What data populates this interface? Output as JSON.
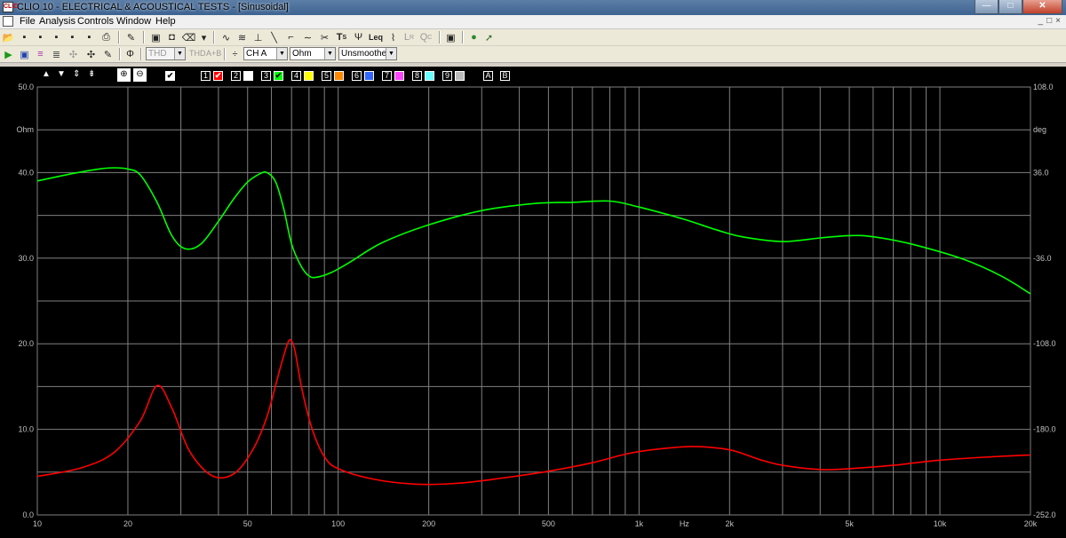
{
  "window": {
    "title": "CLIO 10 - ELECTRICAL & ACOUSTICAL TESTS - [Sinusoidal]",
    "app_icon": "CLIO",
    "min": "—",
    "max": "□",
    "close": "✕"
  },
  "menu": {
    "items": [
      "File",
      "Analysis",
      "Controls",
      "Window",
      "Help"
    ],
    "mdi_buttons": [
      "_",
      "□",
      "×"
    ]
  },
  "toolbar2": {
    "thd_combo": "THD",
    "thd_label": "THD",
    "ab_label": "A+B",
    "channel_combo": "CH A",
    "units_combo": "Ohm",
    "smoothing_combo": "Unsmoothed",
    "ts_label": "T",
    "ts_sub": "S",
    "leq_label": "Leq",
    "lr_label": "L",
    "lr_sub": "R",
    "qc_label": "Q",
    "qc_sub": "C"
  },
  "graph_controls": {
    "overlay_numbers": [
      "1",
      "2",
      "3",
      "4",
      "5",
      "6",
      "7",
      "8",
      "9"
    ],
    "overlay_colors": [
      "#ff0000",
      "#ffffff",
      "#00ff00",
      "#ffff00",
      "#ff8800",
      "#3366ff",
      "#ff44ff",
      "#66ffff",
      "#bbbbbb"
    ],
    "overlay_checked": [
      true,
      false,
      true,
      false,
      false,
      false,
      false,
      false,
      false
    ],
    "ab_letters": [
      "A",
      "B"
    ]
  },
  "chart_data": {
    "type": "line",
    "title": "",
    "xscale": "log",
    "xlim": [
      10,
      20000
    ],
    "x_ticks": [
      {
        "v": 10,
        "label": "10"
      },
      {
        "v": 20,
        "label": "20"
      },
      {
        "v": 50,
        "label": "50"
      },
      {
        "v": 100,
        "label": "100"
      },
      {
        "v": 200,
        "label": "200"
      },
      {
        "v": 500,
        "label": "500"
      },
      {
        "v": 1000,
        "label": "1k"
      },
      {
        "v": 1414,
        "label": "Hz"
      },
      {
        "v": 2000,
        "label": "2k"
      },
      {
        "v": 5000,
        "label": "5k"
      },
      {
        "v": 10000,
        "label": "10k"
      },
      {
        "v": 20000,
        "label": "20k"
      }
    ],
    "xlabel": "Hz",
    "ylabel_left": "Ohm",
    "ylabel_right": "deg",
    "ylim_left": [
      0,
      50
    ],
    "ylim_right": [
      -252,
      108
    ],
    "y_ticks_left": [
      {
        "v": 50,
        "label": "50.0"
      },
      {
        "v": 40,
        "label": "40.0"
      },
      {
        "v": 30,
        "label": "30.0"
      },
      {
        "v": 20,
        "label": "20.0"
      },
      {
        "v": 10,
        "label": "10.0"
      },
      {
        "v": 0,
        "label": "0.0"
      }
    ],
    "y_ticks_right": [
      {
        "v": 108,
        "label": "108.0"
      },
      {
        "v": 36,
        "label": "36.0"
      },
      {
        "v": -36,
        "label": "-36.0"
      },
      {
        "v": -108,
        "label": "-108.0"
      },
      {
        "v": -180,
        "label": "-180.0"
      },
      {
        "v": -252,
        "label": "-252.0"
      }
    ],
    "grid": true,
    "series": [
      {
        "color": "#ff0000",
        "axis": "left",
        "x": [
          10,
          14,
          18,
          22,
          25,
          28,
          32,
          38,
          45,
          52,
          58,
          64,
          68,
          70,
          72,
          76,
          82,
          90,
          100,
          130,
          180,
          250,
          350,
          500,
          700,
          900,
          1100,
          1500,
          2000,
          2500,
          3000,
          4000,
          5000,
          7000,
          10000,
          15000,
          20000
        ],
        "values": [
          4.5,
          5.5,
          7.3,
          11.0,
          15.1,
          12.5,
          7.5,
          4.6,
          4.8,
          7.6,
          11.5,
          17.0,
          20.1,
          20.3,
          19.0,
          14.5,
          10.0,
          6.8,
          5.4,
          4.2,
          3.6,
          3.7,
          4.3,
          5.1,
          6.1,
          7.1,
          7.6,
          8.0,
          7.6,
          6.5,
          5.8,
          5.3,
          5.4,
          5.8,
          6.4,
          6.8,
          7.0
        ]
      },
      {
        "color": "#00ff00",
        "axis": "right",
        "x": [
          10,
          13,
          16,
          18,
          20,
          22,
          25,
          28,
          31,
          35,
          40,
          45,
          50,
          55,
          58,
          62,
          66,
          70,
          75,
          80,
          85,
          95,
          110,
          140,
          200,
          300,
          450,
          600,
          800,
          1000,
          1400,
          1800,
          2200,
          3000,
          4000,
          5000,
          6000,
          8000,
          12000,
          16000,
          20000
        ],
        "values": [
          29,
          35,
          39,
          40,
          39,
          34,
          11,
          -17,
          -28,
          -24,
          -5,
          14,
          28,
          35,
          36,
          28,
          5,
          -24,
          -42,
          -51,
          -52,
          -48,
          -39,
          -23,
          -8,
          4,
          10,
          11,
          12,
          7,
          -3,
          -12,
          -18,
          -22,
          -19,
          -17,
          -18,
          -24,
          -37,
          -51,
          -66
        ]
      }
    ]
  }
}
